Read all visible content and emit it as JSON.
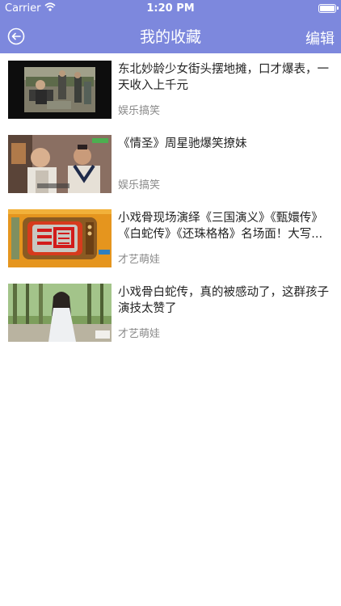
{
  "status_bar": {
    "carrier": "Carrier",
    "time": "1:20 PM",
    "battery_level": 1.0
  },
  "nav": {
    "title": "我的收藏",
    "edit_label": "编辑",
    "back_icon": "back-arrow-circle-icon"
  },
  "colors": {
    "accent": "#7d88dd",
    "title_text": "#222222",
    "category_text": "#8a8a8a"
  },
  "favorites": [
    {
      "title": "东北妙龄少女街头摆地摊，口才爆表，一天收入上千元",
      "category": "娱乐搞笑"
    },
    {
      "title": "《情圣》周星驰爆笑撩妹",
      "category": "娱乐搞笑"
    },
    {
      "title": "小戏骨现场演绎《三国演义》《甄嬛传》《白蛇传》《还珠格格》名场面！大写...",
      "category": "才艺萌娃"
    },
    {
      "title": "小戏骨白蛇传，真的被感动了，这群孩子演技太赞了",
      "category": "才艺萌娃"
    }
  ]
}
